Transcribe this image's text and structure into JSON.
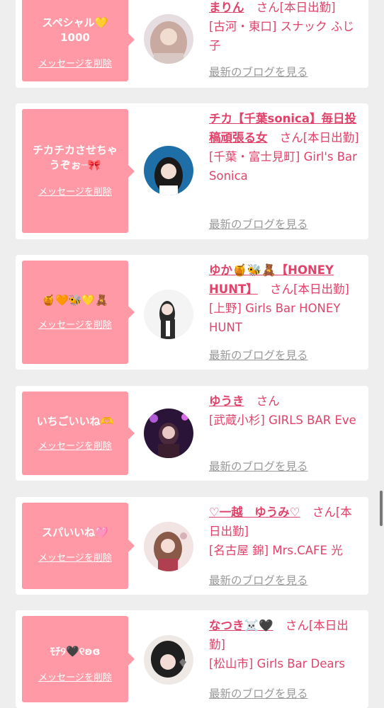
{
  "delete_label": "メッセージを削除",
  "san_label": "さん",
  "blog_label": "最新のブログを見る",
  "colors": {
    "bubble": "#ff99a6",
    "accent": "#e0436a",
    "muted": "#999999"
  },
  "cards": [
    {
      "message_lines": [
        "スペシャル💛",
        "1000"
      ],
      "name": "まりん",
      "status": "[本日出勤]",
      "shop": "[古河・東口] スナック ふじ子"
    },
    {
      "message_lines": [
        "チカチカさせちゃ",
        "うぞぉ┈🎀"
      ],
      "name": "チカ【千葉sonica】毎日投稿頑張る女",
      "status": "[本日出勤]",
      "shop": "[千葉・富士見町] Girl's Bar Sonica"
    },
    {
      "message_lines": [
        "🍯🧡🐝💛🧸"
      ],
      "name": "ゆか🍯🐝🧸【HONEY HUNT】",
      "status": "[本日出勤]",
      "shop": "[上野] Girls Bar HONEY HUNT"
    },
    {
      "message_lines": [
        "いちごいいね🫶"
      ],
      "name": "ゆうき",
      "status": "",
      "shop": "[武蔵小杉] GIRLS BAR Eve"
    },
    {
      "message_lines": [
        "スパいいね🩷"
      ],
      "name": "♡一越　ゆうみ♡",
      "status": "[本日出勤]",
      "shop": "[名古屋 錦] Mrs.CAFE 光"
    },
    {
      "message_lines": [
        "ﾓﾁ୨🖤୧ʚɞ"
      ],
      "name": "なつき☠️🖤",
      "status": "[本日出勤]",
      "shop": "[松山市] Girls Bar Dears"
    }
  ]
}
